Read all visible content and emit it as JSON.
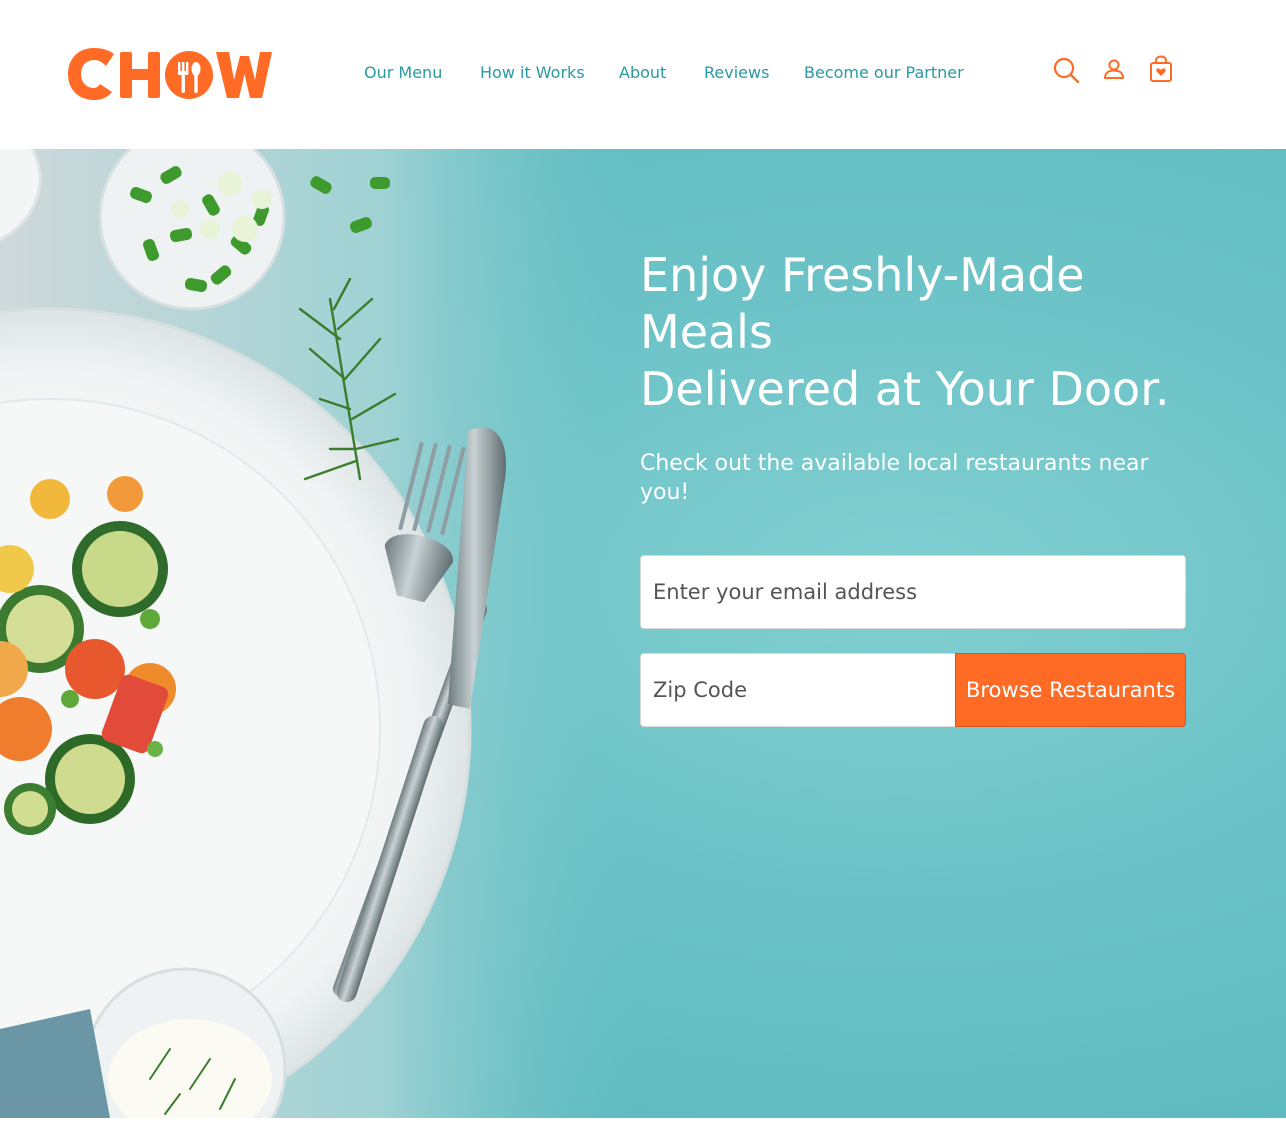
{
  "brand": {
    "name": "CHOW",
    "color": "#ff6a24"
  },
  "nav": {
    "items": [
      {
        "label": "Our Menu"
      },
      {
        "label": "How it Works"
      },
      {
        "label": "About"
      },
      {
        "label": "Reviews"
      },
      {
        "label": "Become our Partner"
      }
    ],
    "color": "#2a9aa3"
  },
  "header_icons": [
    "search-icon",
    "user-icon",
    "shopping-bag-icon"
  ],
  "hero": {
    "headline_line1": "Enjoy Freshly-Made",
    "headline_line2": "Meals",
    "headline_line3": "Delivered at Your Door.",
    "subtext": "Check out the available local restaurants near you!",
    "email_placeholder": "Enter your email address",
    "zip_placeholder": "Zip Code",
    "cta_label": "Browse Restaurants",
    "background_color": "#6cc3c7",
    "cta_color": "#ff6a24"
  }
}
